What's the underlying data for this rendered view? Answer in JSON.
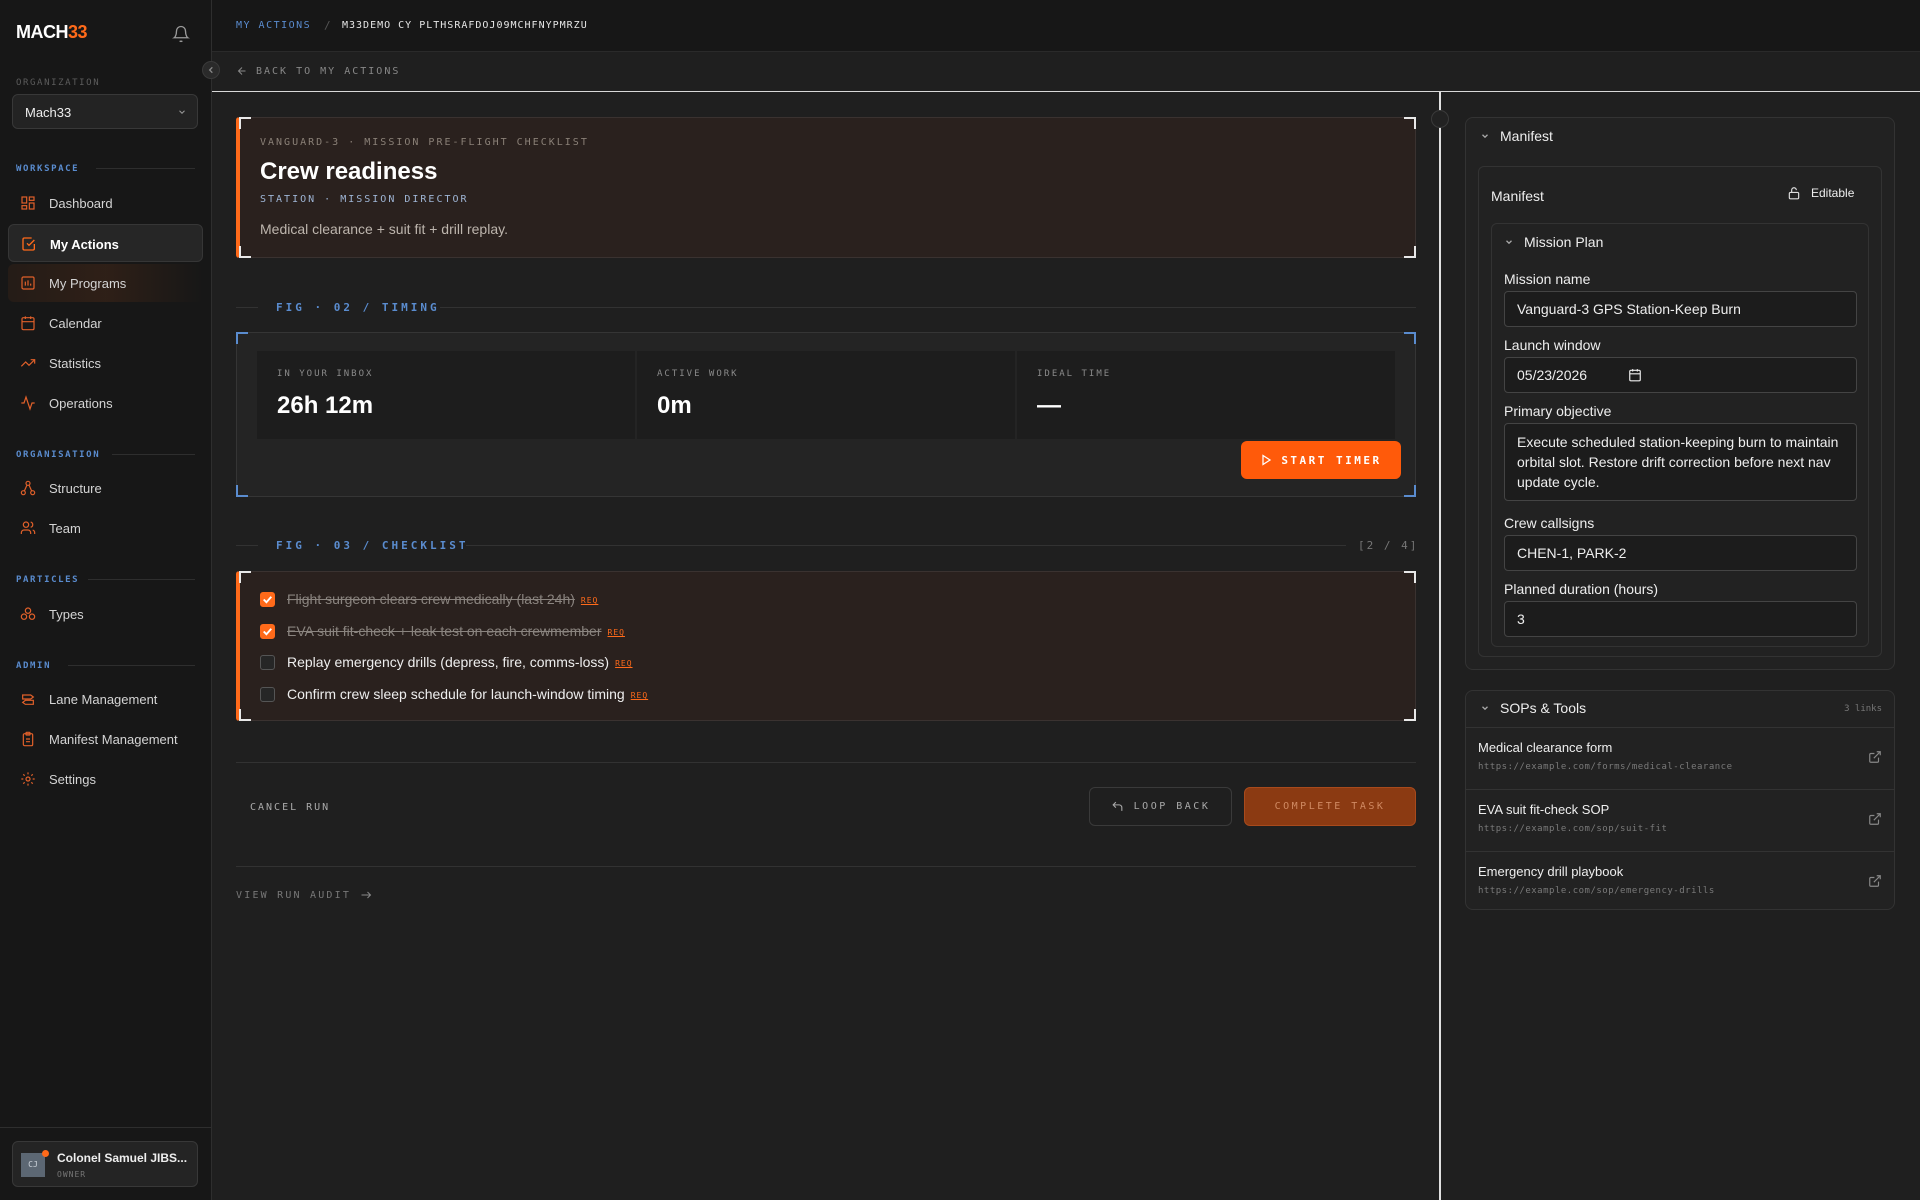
{
  "brand": {
    "name_a": "MACH",
    "name_b": "33"
  },
  "sidebar": {
    "org_label": "ORGANIZATION",
    "org_value": "Mach33",
    "sections": {
      "workspace": "WORKSPACE",
      "organisation": "ORGANISATION",
      "particles": "PARTICLES",
      "admin": "ADMIN"
    },
    "items": [
      {
        "label": "Dashboard",
        "icon": "dashboard-icon"
      },
      {
        "label": "My Actions",
        "icon": "check-square-icon"
      },
      {
        "label": "My Programs",
        "icon": "programs-icon"
      },
      {
        "label": "Calendar",
        "icon": "calendar-icon"
      },
      {
        "label": "Statistics",
        "icon": "trend-icon"
      },
      {
        "label": "Operations",
        "icon": "activity-icon"
      },
      {
        "label": "Structure",
        "icon": "structure-icon"
      },
      {
        "label": "Team",
        "icon": "users-icon"
      },
      {
        "label": "Types",
        "icon": "particles-icon"
      },
      {
        "label": "Lane Management",
        "icon": "lanes-icon"
      },
      {
        "label": "Manifest Management",
        "icon": "clipboard-icon"
      },
      {
        "label": "Settings",
        "icon": "gear-icon"
      }
    ],
    "user": {
      "initials": "CJ",
      "name": "Colonel Samuel JIBS...",
      "role": "OWNER"
    }
  },
  "topbar": {
    "crumb_root": "MY ACTIONS",
    "crumb_sep": "/",
    "crumb_current": "M33DEMO CY PLTHSRAFDOJ09MCHFNYPMRZU"
  },
  "subbar": {
    "back_label": "BACK TO MY ACTIONS"
  },
  "task": {
    "eyebrow": "VANGUARD-3 · MISSION PRE-FLIGHT CHECKLIST",
    "title": "Crew readiness",
    "sub": "STATION · MISSION DIRECTOR",
    "description": "Medical clearance + suit fit + drill replay."
  },
  "timing": {
    "fig_label": "FIG · 02 / TIMING",
    "stats": [
      {
        "label": "IN YOUR INBOX",
        "value": "26h 12m"
      },
      {
        "label": "ACTIVE WORK",
        "value": "0m"
      },
      {
        "label": "IDEAL TIME",
        "value": "—"
      }
    ],
    "start_label": "START TIMER"
  },
  "checklist": {
    "fig_label": "FIG · 03 / CHECKLIST",
    "counter": "[2 / 4]",
    "req_label": "REQ",
    "items": [
      {
        "text": "Flight surgeon clears crew medically (last 24h)",
        "done": true
      },
      {
        "text": "EVA suit fit-check + leak test on each crewmember",
        "done": true
      },
      {
        "text": "Replay emergency drills (depress, fire, comms-loss)",
        "done": false
      },
      {
        "text": "Confirm crew sleep schedule for launch-window timing",
        "done": false
      }
    ]
  },
  "actions": {
    "cancel": "CANCEL RUN",
    "loop_back": "LOOP BACK",
    "complete": "COMPLETE TASK",
    "audit": "VIEW RUN AUDIT"
  },
  "manifest": {
    "panel_title": "Manifest",
    "inner_title": "Manifest",
    "editable": "Editable",
    "plan_title": "Mission Plan",
    "fields": {
      "mission_name": {
        "label": "Mission name",
        "value": "Vanguard-3 GPS Station-Keep Burn"
      },
      "launch_window": {
        "label": "Launch window",
        "value": "05/23/2026"
      },
      "primary_objective": {
        "label": "Primary objective",
        "value": "Execute scheduled station-keeping burn to maintain orbital slot. Restore drift correction before next nav update cycle."
      },
      "crew_callsigns": {
        "label": "Crew callsigns",
        "value": "CHEN-1, PARK-2"
      },
      "planned_duration": {
        "label": "Planned duration (hours)",
        "value": "3"
      }
    }
  },
  "sops": {
    "title": "SOPs & Tools",
    "count": "3 links",
    "links": [
      {
        "name": "Medical clearance form",
        "url": "https://example.com/forms/medical-clearance"
      },
      {
        "name": "EVA suit fit-check SOP",
        "url": "https://example.com/sop/suit-fit"
      },
      {
        "name": "Emergency drill playbook",
        "url": "https://example.com/sop/emergency-drills"
      }
    ]
  },
  "colors": {
    "accent": "#ff6a1a",
    "blue": "#5a8ccf",
    "bg": "#1f1f1f",
    "sidebar": "#171717"
  }
}
